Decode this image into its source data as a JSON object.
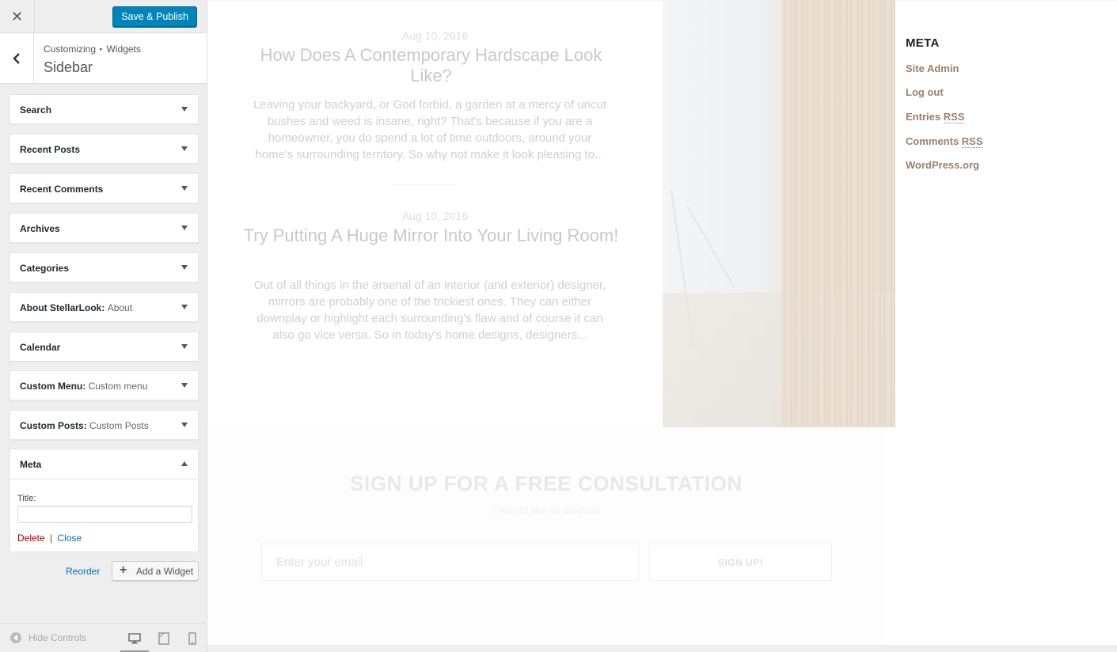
{
  "header": {
    "close_label": "✕",
    "publish_label": "Save & Publish"
  },
  "section": {
    "breadcrumb_root": "Customizing",
    "breadcrumb_sep": "▸",
    "breadcrumb_current": "Widgets",
    "title": "Sidebar"
  },
  "widgets": [
    {
      "title": "Search",
      "sub": ""
    },
    {
      "title": "Recent Posts",
      "sub": ""
    },
    {
      "title": "Recent Comments",
      "sub": ""
    },
    {
      "title": "Archives",
      "sub": ""
    },
    {
      "title": "Categories",
      "sub": ""
    },
    {
      "title": "About StellarLook",
      "sub": "About"
    },
    {
      "title": "Calendar",
      "sub": ""
    },
    {
      "title": "Custom Menu",
      "sub": "Custom menu"
    },
    {
      "title": "Custom Posts",
      "sub": "Custom Posts"
    }
  ],
  "meta_widget": {
    "title": "Meta",
    "field_label": "Title:",
    "field_value": "",
    "delete_label": "Delete",
    "divider": "|",
    "close_label": "Close"
  },
  "actions": {
    "reorder_label": "Reorder",
    "add_widget_label": "Add a Widget"
  },
  "footer": {
    "hide_controls_label": "Hide Controls",
    "devices": [
      "desktop-icon",
      "tablet-icon",
      "mobile-icon"
    ],
    "active_device": "desktop"
  },
  "posts": [
    {
      "date": "Aug 10, 2016",
      "title": "How Does A Contemporary Hardscape Look Like?",
      "excerpt": "Leaving your backyard, or God forbid, a garden at a mercy of uncut bushes and weed is insane, right? That's because if you are a homeowner, you do spend a lot of time outdoors, around your home's surrounding territory. So why not make it look pleasing to..."
    },
    {
      "date": "Aug 10, 2016",
      "title": "Try Putting A Huge Mirror Into Your Living Room!",
      "excerpt": "Out of all things in the arsenal of an interior (and exterior) designer, mirrors are probably one of the trickiest ones. They can either downplay or highlight each surrounding's flaw and of course it can also go vice versa. So in today's home designs, designers..."
    }
  ],
  "sidebar_meta": {
    "heading": "META",
    "links": [
      {
        "text": "Site Admin",
        "abbr": ""
      },
      {
        "text": "Log out",
        "abbr": ""
      },
      {
        "text": "Entries ",
        "abbr": "RSS"
      },
      {
        "text": "Comments ",
        "abbr": "RSS"
      },
      {
        "text": "WordPress.org",
        "abbr": ""
      }
    ]
  },
  "signup": {
    "heading": "SIGN UP FOR A FREE CONSULTATION",
    "subheading": "I would like to discuss",
    "email_placeholder": "Enter your email",
    "button_label": "SIGN UP!"
  },
  "colors": {
    "publish_bg": "#0085ba",
    "link_blue": "#0073aa",
    "delete_red": "#a00",
    "meta_link": "#9c806a"
  }
}
